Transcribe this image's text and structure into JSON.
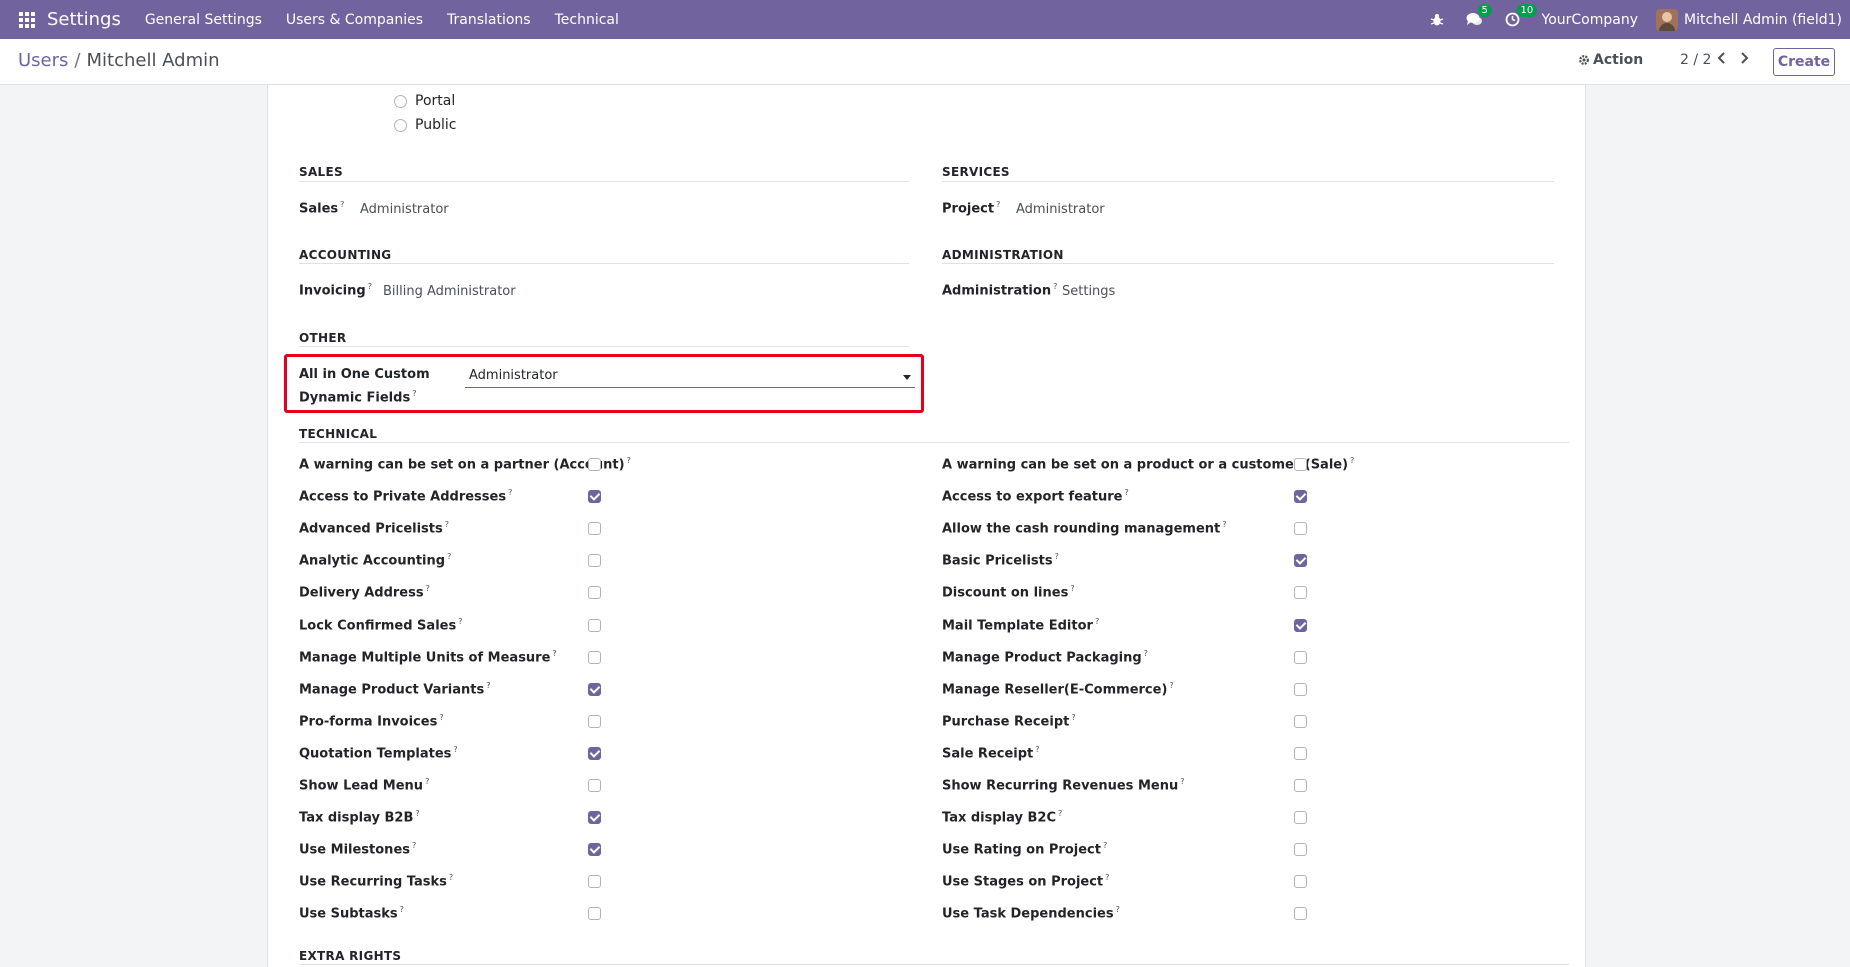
{
  "navbar": {
    "app_title": "Settings",
    "menu": [
      "General Settings",
      "Users & Companies",
      "Translations",
      "Technical"
    ],
    "messages_badge": "5",
    "activities_badge": "10",
    "company": "YourCompany",
    "user": "Mitchell Admin (field1)",
    "accent_color": "#71639e"
  },
  "control_panel": {
    "breadcrumb_parent": "Users",
    "breadcrumb_sep": "/",
    "breadcrumb_current": "Mitchell Admin",
    "action_label": "Action",
    "pager": "2 / 2",
    "create_label": "Create"
  },
  "user_types": [
    "Portal",
    "Public"
  ],
  "sections": {
    "sales": {
      "title": "SALES",
      "label": "Sales",
      "value": "Administrator"
    },
    "services": {
      "title": "SERVICES",
      "label": "Project",
      "value": "Administrator"
    },
    "accounting": {
      "title": "ACCOUNTING",
      "label": "Invoicing",
      "value": "Billing Administrator"
    },
    "administration": {
      "title": "ADMINISTRATION",
      "label": "Administration",
      "value": "Settings"
    },
    "other": {
      "title": "OTHER",
      "label_line1": "All in One Custom",
      "label_line2": "Dynamic Fields",
      "value": "Administrator"
    },
    "technical_title": "TECHNICAL",
    "extra_rights_title": "EXTRA RIGHTS"
  },
  "tooltip_mark": "?",
  "technical_left": [
    {
      "label": "A warning can be set on a partner (Account)",
      "checked": false
    },
    {
      "label": "Access to Private Addresses",
      "checked": true
    },
    {
      "label": "Advanced Pricelists",
      "checked": false
    },
    {
      "label": "Analytic Accounting",
      "checked": false
    },
    {
      "label": "Delivery Address",
      "checked": false
    },
    {
      "label": "Lock Confirmed Sales",
      "checked": false
    },
    {
      "label": "Manage Multiple Units of Measure",
      "checked": false
    },
    {
      "label": "Manage Product Variants",
      "checked": true
    },
    {
      "label": "Pro-forma Invoices",
      "checked": false
    },
    {
      "label": "Quotation Templates",
      "checked": true
    },
    {
      "label": "Show Lead Menu",
      "checked": false
    },
    {
      "label": "Tax display B2B",
      "checked": true
    },
    {
      "label": "Use Milestones",
      "checked": true
    },
    {
      "label": "Use Recurring Tasks",
      "checked": false
    },
    {
      "label": "Use Subtasks",
      "checked": false
    }
  ],
  "technical_right": [
    {
      "label": "A warning can be set on a product or a customer (Sale)",
      "checked": false
    },
    {
      "label": "Access to export feature",
      "checked": true
    },
    {
      "label": "Allow the cash rounding management",
      "checked": false
    },
    {
      "label": "Basic Pricelists",
      "checked": true
    },
    {
      "label": "Discount on lines",
      "checked": false
    },
    {
      "label": "Mail Template Editor",
      "checked": true
    },
    {
      "label": "Manage Product Packaging",
      "checked": false
    },
    {
      "label": "Manage Reseller(E-Commerce)",
      "checked": false
    },
    {
      "label": "Purchase Receipt",
      "checked": false
    },
    {
      "label": "Sale Receipt",
      "checked": false
    },
    {
      "label": "Show Recurring Revenues Menu",
      "checked": false
    },
    {
      "label": "Tax display B2C",
      "checked": false
    },
    {
      "label": "Use Rating on Project",
      "checked": false
    },
    {
      "label": "Use Stages on Project",
      "checked": false
    },
    {
      "label": "Use Task Dependencies",
      "checked": false
    }
  ]
}
